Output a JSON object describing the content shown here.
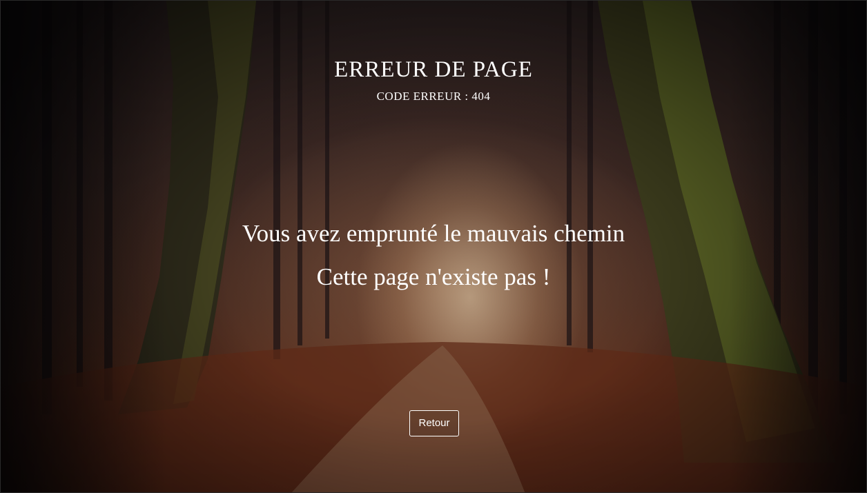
{
  "error_page": {
    "title": "ERREUR DE PAGE",
    "subtitle": "CODE ERREUR : 404",
    "message_line_1": "Vous avez emprunté le mauvais chemin",
    "message_line_2": "Cette page n'existe pas !",
    "back_button_label": "Retour"
  },
  "background": {
    "description_icon": "forest-path-photo",
    "accent_colors": [
      "#5a2e1c",
      "#3b2823",
      "#6b7a2a"
    ]
  }
}
